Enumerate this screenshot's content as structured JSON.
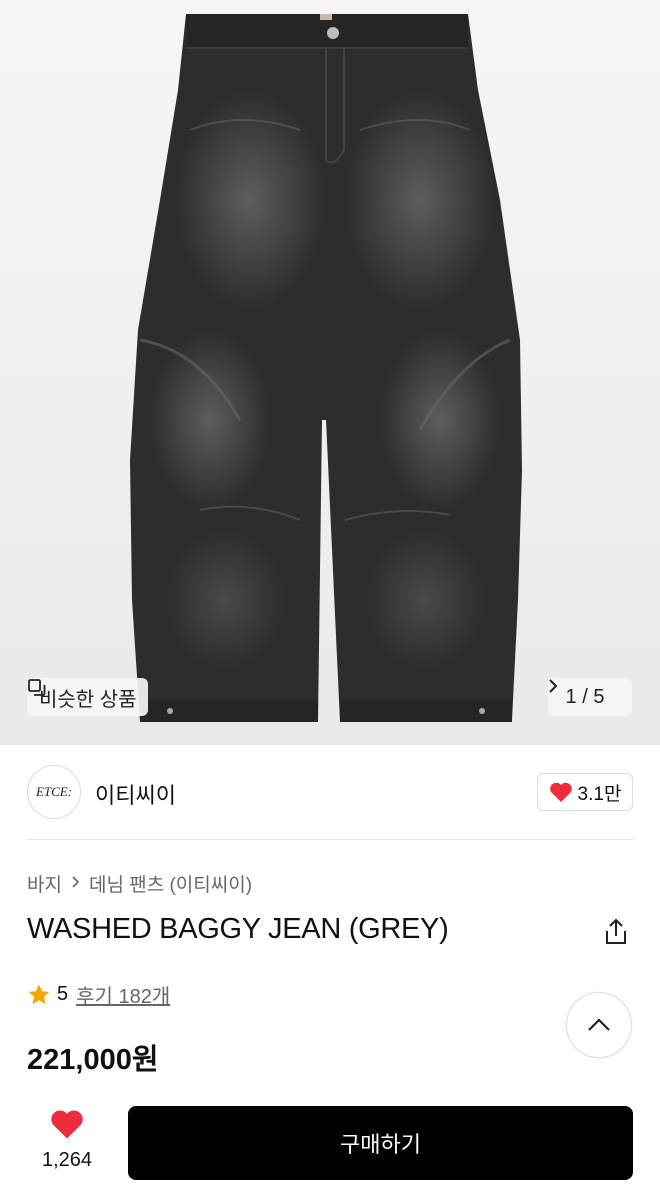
{
  "gallery": {
    "similar_label": "비슷한 상품",
    "pager": "1 / 5"
  },
  "brand": {
    "logo_text": "ETCE:",
    "name": "이티씨이",
    "like_count": "3.1만"
  },
  "breadcrumb": {
    "category": "바지",
    "subcategory": "데님 팬츠 (이티씨이)"
  },
  "product": {
    "title": "WASHED BAGGY JEAN (GREY)",
    "rating": "5",
    "reviews": "후기 182개",
    "price": "221,000원"
  },
  "bottom_bar": {
    "wish_count": "1,264",
    "buy_label": "구매하기"
  },
  "colors": {
    "heart": "#ee2d3c",
    "star": "#f7a600",
    "buy_button": "#000000"
  }
}
